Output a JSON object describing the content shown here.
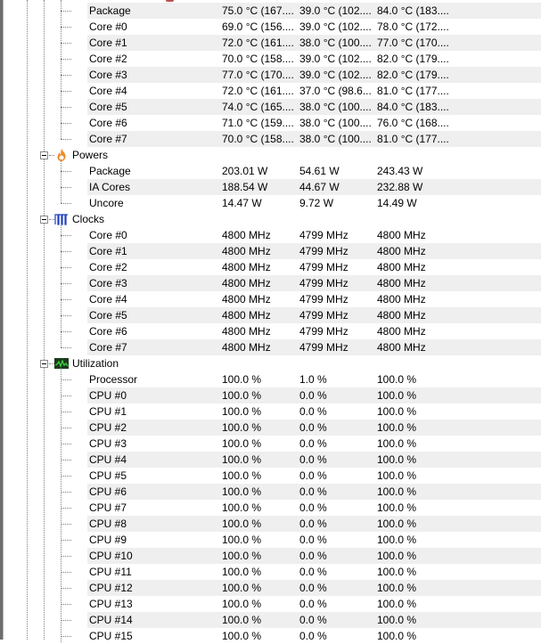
{
  "groups": [
    {
      "key": "temperatures",
      "label": null,
      "icon": "temperature-icon",
      "rows": [
        {
          "name": "Package",
          "current": "75.0 °C  (167....",
          "min": "39.0 °C  (102....",
          "max": "84.0 °C  (183...."
        },
        {
          "name": "Core #0",
          "current": "69.0 °C  (156....",
          "min": "39.0 °C  (102....",
          "max": "78.0 °C  (172...."
        },
        {
          "name": "Core #1",
          "current": "72.0 °C  (161....",
          "min": "38.0 °C  (100....",
          "max": "77.0 °C  (170...."
        },
        {
          "name": "Core #2",
          "current": "70.0 °C  (158....",
          "min": "39.0 °C  (102....",
          "max": "82.0 °C  (179...."
        },
        {
          "name": "Core #3",
          "current": "77.0 °C  (170....",
          "min": "39.0 °C  (102....",
          "max": "82.0 °C  (179...."
        },
        {
          "name": "Core #4",
          "current": "72.0 °C  (161....",
          "min": "37.0 °C  (98.6...",
          "max": "81.0 °C  (177...."
        },
        {
          "name": "Core #5",
          "current": "74.0 °C  (165....",
          "min": "38.0 °C  (100....",
          "max": "84.0 °C  (183...."
        },
        {
          "name": "Core #6",
          "current": "71.0 °C  (159....",
          "min": "38.0 °C  (100....",
          "max": "76.0 °C  (168...."
        },
        {
          "name": "Core #7",
          "current": "70.0 °C  (158....",
          "min": "38.0 °C  (100....",
          "max": "81.0 °C  (177...."
        }
      ]
    },
    {
      "key": "powers",
      "label": "Powers",
      "icon": "flame-icon",
      "rows": [
        {
          "name": "Package",
          "current": "203.01 W",
          "min": "54.61 W",
          "max": "243.43 W"
        },
        {
          "name": "IA Cores",
          "current": "188.54 W",
          "min": "44.67 W",
          "max": "232.88 W"
        },
        {
          "name": "Uncore",
          "current": "14.47 W",
          "min": "9.72 W",
          "max": "14.49 W"
        }
      ]
    },
    {
      "key": "clocks",
      "label": "Clocks",
      "icon": "clock-wave-icon",
      "rows": [
        {
          "name": "Core #0",
          "current": "4800 MHz",
          "min": "4799 MHz",
          "max": "4800 MHz"
        },
        {
          "name": "Core #1",
          "current": "4800 MHz",
          "min": "4799 MHz",
          "max": "4800 MHz"
        },
        {
          "name": "Core #2",
          "current": "4800 MHz",
          "min": "4799 MHz",
          "max": "4800 MHz"
        },
        {
          "name": "Core #3",
          "current": "4800 MHz",
          "min": "4799 MHz",
          "max": "4800 MHz"
        },
        {
          "name": "Core #4",
          "current": "4800 MHz",
          "min": "4799 MHz",
          "max": "4800 MHz"
        },
        {
          "name": "Core #5",
          "current": "4800 MHz",
          "min": "4799 MHz",
          "max": "4800 MHz"
        },
        {
          "name": "Core #6",
          "current": "4800 MHz",
          "min": "4799 MHz",
          "max": "4800 MHz"
        },
        {
          "name": "Core #7",
          "current": "4800 MHz",
          "min": "4799 MHz",
          "max": "4800 MHz"
        }
      ]
    },
    {
      "key": "utilization",
      "label": "Utilization",
      "icon": "utilization-graph-icon",
      "rows": [
        {
          "name": "Processor",
          "current": "100.0 %",
          "min": "1.0 %",
          "max": "100.0 %"
        },
        {
          "name": "CPU #0",
          "current": "100.0 %",
          "min": "0.0 %",
          "max": "100.0 %"
        },
        {
          "name": "CPU #1",
          "current": "100.0 %",
          "min": "0.0 %",
          "max": "100.0 %"
        },
        {
          "name": "CPU #2",
          "current": "100.0 %",
          "min": "0.0 %",
          "max": "100.0 %"
        },
        {
          "name": "CPU #3",
          "current": "100.0 %",
          "min": "0.0 %",
          "max": "100.0 %"
        },
        {
          "name": "CPU #4",
          "current": "100.0 %",
          "min": "0.0 %",
          "max": "100.0 %"
        },
        {
          "name": "CPU #5",
          "current": "100.0 %",
          "min": "0.0 %",
          "max": "100.0 %"
        },
        {
          "name": "CPU #6",
          "current": "100.0 %",
          "min": "0.0 %",
          "max": "100.0 %"
        },
        {
          "name": "CPU #7",
          "current": "100.0 %",
          "min": "0.0 %",
          "max": "100.0 %"
        },
        {
          "name": "CPU #8",
          "current": "100.0 %",
          "min": "0.0 %",
          "max": "100.0 %"
        },
        {
          "name": "CPU #9",
          "current": "100.0 %",
          "min": "0.0 %",
          "max": "100.0 %"
        },
        {
          "name": "CPU #10",
          "current": "100.0 %",
          "min": "0.0 %",
          "max": "100.0 %"
        },
        {
          "name": "CPU #11",
          "current": "100.0 %",
          "min": "0.0 %",
          "max": "100.0 %"
        },
        {
          "name": "CPU #12",
          "current": "100.0 %",
          "min": "0.0 %",
          "max": "100.0 %"
        },
        {
          "name": "CPU #13",
          "current": "100.0 %",
          "min": "0.0 %",
          "max": "100.0 %"
        },
        {
          "name": "CPU #14",
          "current": "100.0 %",
          "min": "0.0 %",
          "max": "100.0 %"
        },
        {
          "name": "CPU #15",
          "current": "100.0 %",
          "min": "0.0 %",
          "max": "100.0 %"
        }
      ]
    }
  ],
  "colors": {
    "stripe": "#efefef",
    "tree_lines": "#808080",
    "flame": "#f08a24",
    "clock_wave": "#1f3fbf",
    "util_bg": "#1a3a1a",
    "util_line": "#3ddc3d"
  }
}
